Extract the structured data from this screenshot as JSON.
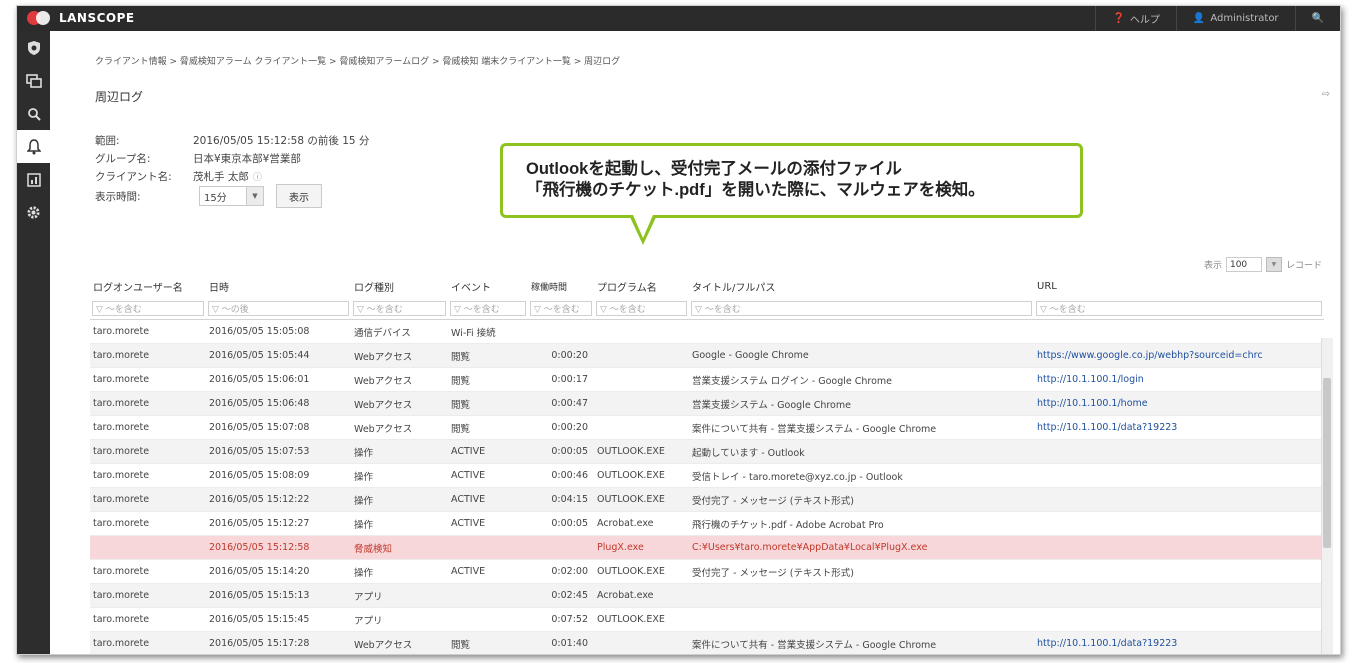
{
  "app": {
    "name": "LANSCOPE"
  },
  "topbar": {
    "help_label": "ヘルプ",
    "user_label": "Administrator"
  },
  "breadcrumb": "クライアント情報 > 脅威検知アラーム クライアント一覧 > 脅威検知アラームログ > 脅威検知 端末クライアント一覧 > 周辺ログ",
  "page_title": "周辺ログ",
  "info": {
    "range_label": "範囲:",
    "range_value": "2016/05/05 15:12:58 の前後 15 分",
    "group_label": "グループ名:",
    "group_value": "日本¥東京本部¥営業部",
    "client_label": "クライアント名:",
    "client_value": "茂札手 太郎",
    "time_label": "表示時間:",
    "time_value": "15分",
    "show_button": "表示"
  },
  "callout": {
    "line1": "Outlookを起動し、受付完了メールの添付ファイル",
    "line2": "「飛行機のチケット.pdf」を開いた際に、マルウェアを検知。"
  },
  "pager": {
    "prefix": "表示",
    "value": "100",
    "suffix": "レコード"
  },
  "table": {
    "headers": [
      "ログオンユーザー名",
      "日時",
      "ログ種別",
      "イベント",
      "稼働時間",
      "プログラム名",
      "タイトル/フルパス",
      "URL"
    ],
    "filter_placeholder": "▽ ～を含む",
    "filter_date_placeholder": "▽ ～の後",
    "rows": [
      {
        "user": "taro.morete",
        "date": "2016/05/05 15:05:08",
        "type": "通信デバイス",
        "event": "Wi-Fi 接続",
        "time": "",
        "program": "",
        "title": "",
        "url": ""
      },
      {
        "user": "taro.morete",
        "date": "2016/05/05 15:05:44",
        "type": "Webアクセス",
        "event": "閲覧",
        "time": "0:00:20",
        "program": "",
        "title": "Google - Google Chrome",
        "url": "https://www.google.co.jp/webhp?sourceid=chrc"
      },
      {
        "user": "taro.morete",
        "date": "2016/05/05 15:06:01",
        "type": "Webアクセス",
        "event": "閲覧",
        "time": "0:00:17",
        "program": "",
        "title": "営業支援システム ログイン - Google Chrome",
        "url": "http://10.1.100.1/login"
      },
      {
        "user": "taro.morete",
        "date": "2016/05/05 15:06:48",
        "type": "Webアクセス",
        "event": "閲覧",
        "time": "0:00:47",
        "program": "",
        "title": "営業支援システム - Google Chrome",
        "url": "http://10.1.100.1/home"
      },
      {
        "user": "taro.morete",
        "date": "2016/05/05 15:07:08",
        "type": "Webアクセス",
        "event": "閲覧",
        "time": "0:00:20",
        "program": "",
        "title": "案件について共有 - 営業支援システム - Google Chrome",
        "url": "http://10.1.100.1/data?19223"
      },
      {
        "user": "taro.morete",
        "date": "2016/05/05 15:07:53",
        "type": "操作",
        "event": "ACTIVE",
        "time": "0:00:05",
        "program": "OUTLOOK.EXE",
        "title": "起動しています - Outlook",
        "url": ""
      },
      {
        "user": "taro.morete",
        "date": "2016/05/05 15:08:09",
        "type": "操作",
        "event": "ACTIVE",
        "time": "0:00:46",
        "program": "OUTLOOK.EXE",
        "title": "受信トレイ - taro.morete@xyz.co.jp - Outlook",
        "url": ""
      },
      {
        "user": "taro.morete",
        "date": "2016/05/05 15:12:22",
        "type": "操作",
        "event": "ACTIVE",
        "time": "0:04:15",
        "program": "OUTLOOK.EXE",
        "title": "受付完了 - メッセージ (テキスト形式)",
        "url": ""
      },
      {
        "user": "taro.morete",
        "date": "2016/05/05 15:12:27",
        "type": "操作",
        "event": "ACTIVE",
        "time": "0:00:05",
        "program": "Acrobat.exe",
        "title": "飛行機のチケット.pdf - Adobe Acrobat Pro",
        "url": ""
      },
      {
        "user": "",
        "date": "2016/05/05 15:12:58",
        "type": "脅威検知",
        "event": "",
        "time": "",
        "program": "PlugX.exe",
        "title": "C:¥Users¥taro.morete¥AppData¥Local¥PlugX.exe",
        "url": ""
      },
      {
        "user": "taro.morete",
        "date": "2016/05/05 15:14:20",
        "type": "操作",
        "event": "ACTIVE",
        "time": "0:02:00",
        "program": "OUTLOOK.EXE",
        "title": "受付完了 - メッセージ (テキスト形式)",
        "url": ""
      },
      {
        "user": "taro.morete",
        "date": "2016/05/05 15:15:13",
        "type": "アプリ",
        "event": "",
        "time": "0:02:45",
        "program": "Acrobat.exe",
        "title": "",
        "url": ""
      },
      {
        "user": "taro.morete",
        "date": "2016/05/05 15:15:45",
        "type": "アプリ",
        "event": "",
        "time": "0:07:52",
        "program": "OUTLOOK.EXE",
        "title": "",
        "url": ""
      },
      {
        "user": "taro.morete",
        "date": "2016/05/05 15:17:28",
        "type": "Webアクセス",
        "event": "閲覧",
        "time": "0:01:40",
        "program": "",
        "title": "案件について共有 - 営業支援システム - Google Chrome",
        "url": "http://10.1.100.1/data?19223"
      }
    ]
  },
  "colors": {
    "accent_green": "#8dc21f",
    "alert_row": "#f8d7da",
    "alert_text": "#c0392b",
    "topbar": "#2b2b2b"
  }
}
